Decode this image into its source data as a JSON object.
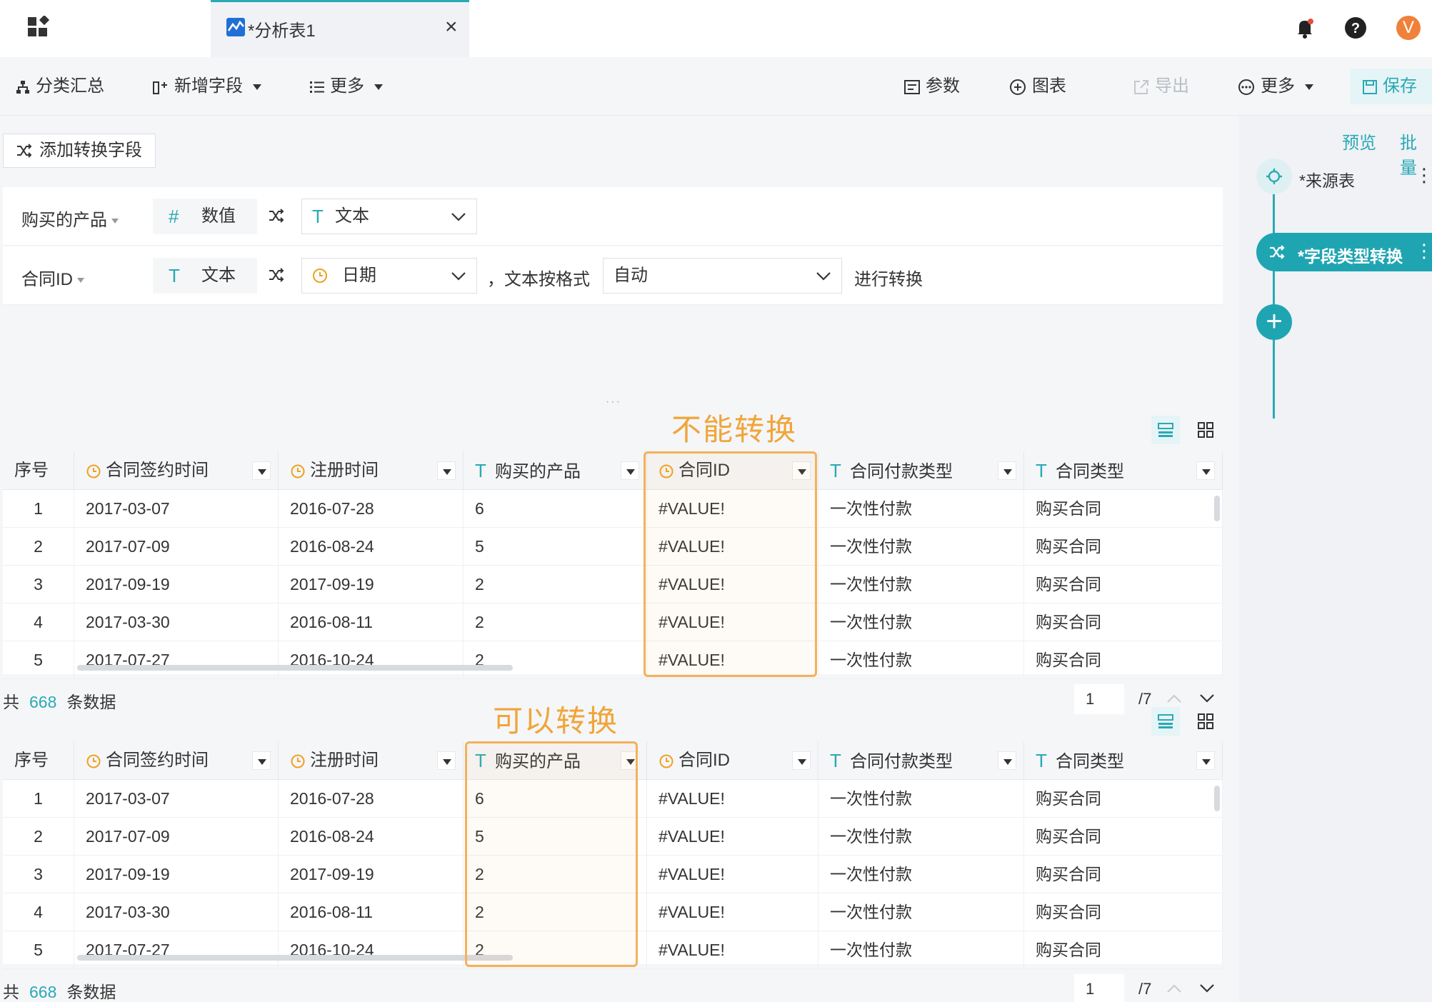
{
  "tab": {
    "title": "*分析表1",
    "close": "×"
  },
  "avatar": "V",
  "toolbar": {
    "summary": "分类汇总",
    "add_field": "新增字段",
    "more_left": "更多",
    "params": "参数",
    "chart": "图表",
    "export": "导出",
    "more_right": "更多",
    "save": "保存"
  },
  "config": {
    "add_button": "添加转换字段",
    "rows": [
      {
        "field": "购买的产品",
        "from_icon": "#",
        "from_type": "数值",
        "to_type": "文本",
        "to_icon": "T"
      },
      {
        "field": "合同ID",
        "from_icon": "T",
        "from_type": "文本",
        "to_type": "日期",
        "to_icon": "clock",
        "format_prefix": "，文本按格式",
        "format_value": "自动",
        "suffix": "进行转换"
      }
    ],
    "handle": "···"
  },
  "flow": {
    "preview": "预览",
    "batch": "批量",
    "source_node": "*来源表",
    "convert_node": "*字段类型转换",
    "more": "⋮",
    "add": "+"
  },
  "annotations": {
    "top": "不能转换",
    "bottom": "可以转换"
  },
  "table": {
    "columns": [
      {
        "label": "序号",
        "type": ""
      },
      {
        "label": "合同签约时间",
        "type": "clock"
      },
      {
        "label": "注册时间",
        "type": "clock"
      },
      {
        "label": "购买的产品",
        "type": "T"
      },
      {
        "label": "合同ID",
        "type": "clock"
      },
      {
        "label": "合同付款类型",
        "type": "T"
      },
      {
        "label": "合同类型",
        "type": "T"
      }
    ],
    "rows": [
      [
        "1",
        "2017-03-07",
        "2016-07-28",
        "6",
        "#VALUE!",
        "一次性付款",
        "购买合同"
      ],
      [
        "2",
        "2017-07-09",
        "2016-08-24",
        "5",
        "#VALUE!",
        "一次性付款",
        "购买合同"
      ],
      [
        "3",
        "2017-09-19",
        "2017-09-19",
        "2",
        "#VALUE!",
        "一次性付款",
        "购买合同"
      ],
      [
        "4",
        "2017-03-30",
        "2016-08-11",
        "2",
        "#VALUE!",
        "一次性付款",
        "购买合同"
      ],
      [
        "5",
        "2017-07-27",
        "2016-10-24",
        "2",
        "#VALUE!",
        "一次性付款",
        "购买合同"
      ]
    ]
  },
  "pager": {
    "prefix": "共",
    "count": "668",
    "suffix": "条数据",
    "page": "1",
    "total_pages": "/7"
  },
  "colors": {
    "accent": "#2aa9b5",
    "highlight": "#f4b15a",
    "annotation": "#f0a53a",
    "avatar": "#f0813a"
  }
}
